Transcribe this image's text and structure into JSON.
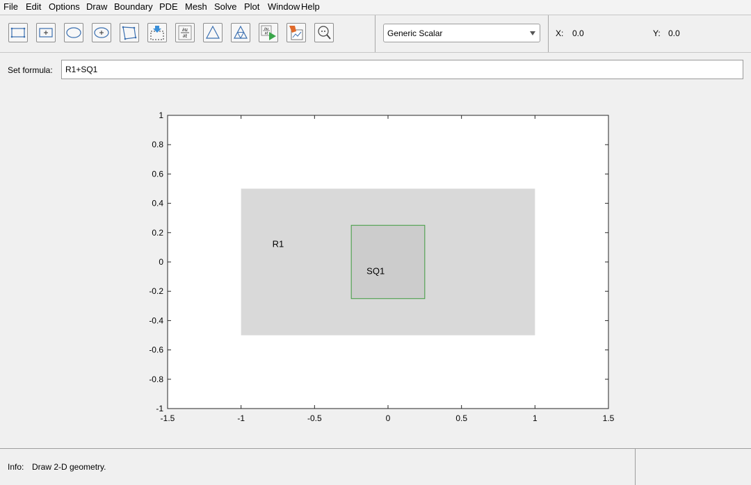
{
  "menu": [
    "File",
    "Edit",
    "Options",
    "Draw",
    "Boundary",
    "PDE",
    "Mesh",
    "Solve",
    "Plot",
    "Window",
    "Help"
  ],
  "toolbar": {
    "buttons": [
      "rectangle",
      "rectangle-centered",
      "ellipse",
      "ellipse-centered",
      "polygon",
      "boundary-mode",
      "pde-specification",
      "initialize-mesh",
      "refine-mesh",
      "solve-pde",
      "plot-solution",
      "zoom"
    ],
    "application_mode": "Generic Scalar",
    "x_label": "X:",
    "x_value": "0.0",
    "y_label": "Y:",
    "y_value": "0.0"
  },
  "formula": {
    "label": "Set formula:",
    "value": "R1+SQ1"
  },
  "axes": {
    "xlim": [
      -1.5,
      1.5
    ],
    "ylim": [
      -1,
      1
    ],
    "xticks": [
      "-1.5",
      "-1",
      "-0.5",
      "0",
      "0.5",
      "1",
      "1.5"
    ],
    "yticks": [
      "1",
      "0.8",
      "0.6",
      "0.4",
      "0.2",
      "0",
      "-0.2",
      "-0.4",
      "-0.6",
      "-0.8",
      "-1"
    ],
    "shapes": [
      {
        "label": "R1",
        "xmin": -1,
        "xmax": 1,
        "ymin": -0.5,
        "ymax": 0.5,
        "fill": "#d9d9d9",
        "stroke": "none"
      },
      {
        "label": "SQ1",
        "xmin": -0.25,
        "xmax": 0.25,
        "ymin": -0.25,
        "ymax": 0.25,
        "fill": "#cccccc",
        "stroke": "#3c9a3c"
      }
    ]
  },
  "info": {
    "label": "Info:",
    "text": "Draw 2-D geometry."
  }
}
